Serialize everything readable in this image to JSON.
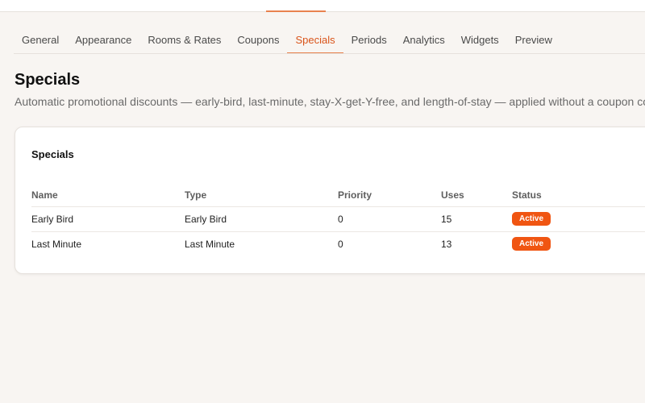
{
  "tabs": [
    {
      "label": "General",
      "active": false
    },
    {
      "label": "Appearance",
      "active": false
    },
    {
      "label": "Rooms & Rates",
      "active": false
    },
    {
      "label": "Coupons",
      "active": false
    },
    {
      "label": "Specials",
      "active": true
    },
    {
      "label": "Periods",
      "active": false
    },
    {
      "label": "Analytics",
      "active": false
    },
    {
      "label": "Widgets",
      "active": false
    },
    {
      "label": "Preview",
      "active": false
    }
  ],
  "page": {
    "title": "Specials",
    "subtitle": "Automatic promotional discounts — early-bird, last-minute, stay-X-get-Y-free, and length-of-stay — applied without a coupon code."
  },
  "card": {
    "title": "Specials",
    "columns": [
      "Name",
      "Type",
      "Priority",
      "Uses",
      "Status"
    ],
    "rows": [
      {
        "name": "Early Bird",
        "type": "Early Bird",
        "priority": "0",
        "uses": "15",
        "status": "Active"
      },
      {
        "name": "Last Minute",
        "type": "Last Minute",
        "priority": "0",
        "uses": "13",
        "status": "Active"
      }
    ]
  },
  "colors": {
    "accent": "#e8824f",
    "badge": "#f05512",
    "background": "#f8f5f2"
  }
}
